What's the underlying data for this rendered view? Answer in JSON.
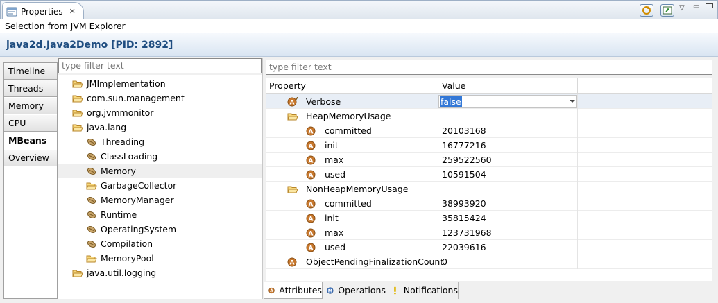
{
  "view": {
    "tab_label": "Properties",
    "close_glyph": "✕"
  },
  "selection_source": "Selection from JVM Explorer",
  "process_title": "java2d.Java2Demo [PID: 2892]",
  "left_tabs": [
    {
      "label": "Timeline",
      "active": false
    },
    {
      "label": "Threads",
      "active": false
    },
    {
      "label": "Memory",
      "active": false
    },
    {
      "label": "CPU",
      "active": false
    },
    {
      "label": "MBeans",
      "active": true
    },
    {
      "label": "Overview",
      "active": false
    }
  ],
  "tree_filter": {
    "placeholder": "type filter text"
  },
  "tree": [
    {
      "label": "JMImplementation",
      "icon": "open-folder",
      "level": 0
    },
    {
      "label": "com.sun.management",
      "icon": "open-folder",
      "level": 0
    },
    {
      "label": "org.jvmmonitor",
      "icon": "open-folder",
      "level": 0
    },
    {
      "label": "java.lang",
      "icon": "open-folder",
      "level": 0
    },
    {
      "label": "Threading",
      "icon": "bean",
      "level": 1
    },
    {
      "label": "ClassLoading",
      "icon": "bean",
      "level": 1
    },
    {
      "label": "Memory",
      "icon": "bean",
      "level": 1,
      "selected": true
    },
    {
      "label": "GarbageCollector",
      "icon": "open-folder",
      "level": 1
    },
    {
      "label": "MemoryManager",
      "icon": "bean",
      "level": 1
    },
    {
      "label": "Runtime",
      "icon": "bean",
      "level": 1
    },
    {
      "label": "OperatingSystem",
      "icon": "bean",
      "level": 1
    },
    {
      "label": "Compilation",
      "icon": "bean",
      "level": 1
    },
    {
      "label": "MemoryPool",
      "icon": "open-folder",
      "level": 1
    },
    {
      "label": "java.util.logging",
      "icon": "open-folder",
      "level": 0
    }
  ],
  "attr_filter": {
    "placeholder": "type filter text"
  },
  "table": {
    "columns": [
      "Property",
      "Value"
    ],
    "rows": [
      {
        "name": "Verbose",
        "value": "false",
        "icon": "attribute-writable",
        "level": 1,
        "editing": true
      },
      {
        "name": "HeapMemoryUsage",
        "value": "",
        "icon": "open-folder",
        "level": 1
      },
      {
        "name": "committed",
        "value": "20103168",
        "icon": "attribute",
        "level": 2
      },
      {
        "name": "init",
        "value": "16777216",
        "icon": "attribute",
        "level": 2
      },
      {
        "name": "max",
        "value": "259522560",
        "icon": "attribute",
        "level": 2
      },
      {
        "name": "used",
        "value": "10591504",
        "icon": "attribute",
        "level": 2
      },
      {
        "name": "NonHeapMemoryUsage",
        "value": "",
        "icon": "open-folder",
        "level": 1
      },
      {
        "name": "committed",
        "value": "38993920",
        "icon": "attribute",
        "level": 2
      },
      {
        "name": "init",
        "value": "35815424",
        "icon": "attribute",
        "level": 2
      },
      {
        "name": "max",
        "value": "123731968",
        "icon": "attribute",
        "level": 2
      },
      {
        "name": "used",
        "value": "22039616",
        "icon": "attribute",
        "level": 2
      },
      {
        "name": "ObjectPendingFinalizationCount",
        "value": "0",
        "icon": "attribute",
        "level": 1
      }
    ]
  },
  "bottom_tabs": [
    {
      "label": "Attributes",
      "icon": "attribute",
      "active": true
    },
    {
      "label": "Operations",
      "icon": "operation",
      "active": false
    },
    {
      "label": "Notifications",
      "icon": "notification",
      "active": false
    }
  ],
  "colors": {
    "title": "#1f4d80",
    "attribute_icon": "#c7772c",
    "selection": "#3378d7"
  }
}
